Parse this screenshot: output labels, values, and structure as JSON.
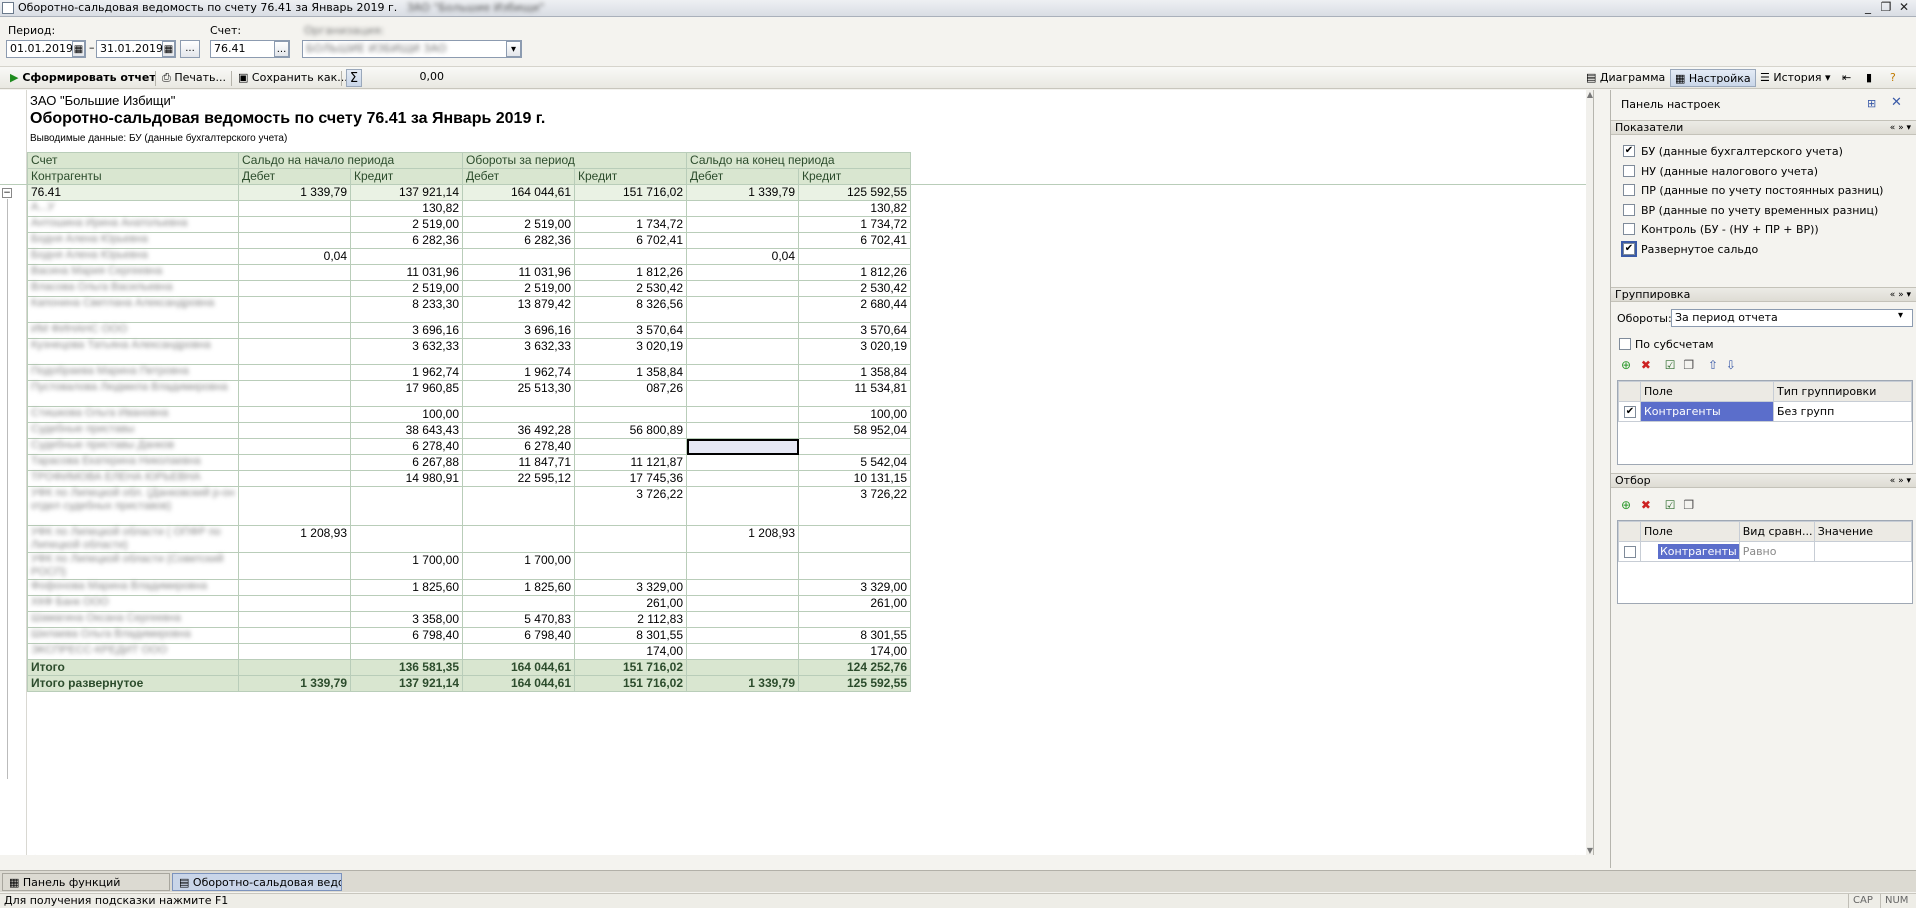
{
  "window": {
    "title": "Оборотно-сальдовая ведомость по счету 76.41 за Январь 2019 г.",
    "title_org_blurred": "ЗАО \"Большие Избищи\"",
    "controls": [
      "_",
      "❐",
      "✕"
    ]
  },
  "params": {
    "period_label": "Период:",
    "date_from": "01.01.2019",
    "date_to": "31.01.2019",
    "dash": "–",
    "more": "...",
    "account_label": "Счет:",
    "account_value": "76.41",
    "org_label": "Организация:",
    "org_value": "БОЛЬШИЕ ИЗБИЩИ ЗАО"
  },
  "toolbar": {
    "generate": "Сформировать отчет",
    "print": "Печать...",
    "save": "Сохранить как...",
    "sigma": "Σ",
    "sum_value": "0,00",
    "diagram": "Диаграмма",
    "settings": "Настройка",
    "history": "История ▾"
  },
  "report": {
    "org": "ЗАО \"Большие Избищи\"",
    "title": "Оборотно-сальдовая ведомость по счету 76.41 за Январь 2019 г.",
    "subtitle": "Выводимые данные:  БУ (данные бухгалтерского учета)",
    "header1": [
      "Счет",
      "Сальдо на начало периода",
      "Обороты за период",
      "Сальдо на конец периода"
    ],
    "header2": [
      "Контрагенты",
      "Дебет",
      "Кредит",
      "Дебет",
      "Кредит",
      "Дебет",
      "Кредит"
    ],
    "account_row": [
      "76.41",
      "1 339,79",
      "137 921,14",
      "164 044,61",
      "151 716,02",
      "1 339,79",
      "125 592,55"
    ],
    "rows": [
      {
        "name": "А...У",
        "v": [
          "",
          "130,82",
          "",
          "",
          "",
          "130,82"
        ],
        "h": 1
      },
      {
        "name": "Антошина Ирина Анатольевна",
        "v": [
          "",
          "2 519,00",
          "2 519,00",
          "1 734,72",
          "",
          "1 734,72"
        ],
        "h": 1
      },
      {
        "name": "Бодня Алена Юрьевна",
        "v": [
          "",
          "6 282,36",
          "6 282,36",
          "6 702,41",
          "",
          "6 702,41"
        ],
        "h": 1
      },
      {
        "name": "Бодня Алена Юрьевна",
        "v": [
          "0,04",
          "",
          "",
          "",
          "0,04",
          ""
        ],
        "h": 1
      },
      {
        "name": "Васина Мария Сергеевна",
        "v": [
          "",
          "11 031,96",
          "11 031,96",
          "1 812,26",
          "",
          "1 812,26"
        ],
        "h": 1
      },
      {
        "name": "Власова Ольга Васильевна",
        "v": [
          "",
          "2 519,00",
          "2 519,00",
          "2 530,42",
          "",
          "2 530,42"
        ],
        "h": 1
      },
      {
        "name": "Капонина Светлана Александровна",
        "v": [
          "",
          "8 233,30",
          "13 879,42",
          "8 326,56",
          "",
          "2 680,44"
        ],
        "h": 2
      },
      {
        "name": "ИМ ФИНАНС ООО",
        "v": [
          "",
          "3 696,16",
          "3 696,16",
          "3 570,64",
          "",
          "3 570,64"
        ],
        "h": 1
      },
      {
        "name": "Кузнецова Татьяна Александровна",
        "v": [
          "",
          "3 632,33",
          "3 632,33",
          "3 020,19",
          "",
          "3 020,19"
        ],
        "h": 2
      },
      {
        "name": "Подобраева Марина Петровна",
        "v": [
          "",
          "1 962,74",
          "1 962,74",
          "1 358,84",
          "",
          "1 358,84"
        ],
        "h": 1
      },
      {
        "name": "Пустовалова Людмила Владимировна",
        "v": [
          "",
          "17 960,85",
          "25 513,30",
          "087,26",
          "",
          "11 534,81"
        ],
        "h": 2
      },
      {
        "name": "Стишкова Ольга Ивановна",
        "v": [
          "",
          "100,00",
          "",
          "",
          "",
          "100,00"
        ],
        "h": 1
      },
      {
        "name": "Судебные приставы",
        "v": [
          "",
          "38 643,43",
          "36 492,28",
          "56 800,89",
          "",
          "58 952,04"
        ],
        "h": 1
      },
      {
        "name": "Судебные приставы Данков",
        "v": [
          "",
          "6 278,40",
          "6 278,40",
          "",
          "",
          ""
        ],
        "h": 1,
        "sel": 4
      },
      {
        "name": "Тарасова Екатерина Николаевна",
        "v": [
          "",
          "6 267,88",
          "11 847,71",
          "11 121,87",
          "",
          "5 542,04"
        ],
        "h": 1
      },
      {
        "name": "ТРОФИМОВА ЕЛЕНА ЮРЬЕВНА",
        "v": [
          "",
          "14 980,91",
          "22 595,12",
          "17 745,36",
          "",
          "10 131,15"
        ],
        "h": 1
      },
      {
        "name": "УФК по Липецкой обл. (Данковский р-он отдел судебных приставов)",
        "v": [
          "",
          "",
          "",
          "3 726,22",
          "",
          "3 726,22"
        ],
        "h": 3
      },
      {
        "name": "УФК по Липецкой области ( ОПФР по Липецкой области)",
        "v": [
          "1 208,93",
          "",
          "",
          "",
          "1 208,93",
          ""
        ],
        "h": 2
      },
      {
        "name": "УФК по Липецкой области (Советский РОСП)",
        "v": [
          "",
          "1 700,00",
          "1 700,00",
          "",
          "",
          ""
        ],
        "h": 2
      },
      {
        "name": "Фофонова Марина Владимировна",
        "v": [
          "",
          "1 825,60",
          "1 825,60",
          "3 329,00",
          "",
          "3 329,00"
        ],
        "h": 1
      },
      {
        "name": "ХКФ Банк ООО",
        "v": [
          "",
          "",
          "",
          "261,00",
          "",
          "261,00"
        ],
        "h": 1
      },
      {
        "name": "Шамагина Оксана Сергеевна",
        "v": [
          "",
          "3 358,00",
          "5 470,83",
          "2 112,83",
          "",
          ""
        ],
        "h": 1
      },
      {
        "name": "Шилаева Ольга Владимировна",
        "v": [
          "",
          "6 798,40",
          "6 798,40",
          "8 301,55",
          "",
          "8 301,55"
        ],
        "h": 1
      },
      {
        "name": "ЭКСПРЕСС-КРЕДИТ ООО",
        "v": [
          "",
          "",
          "",
          "174,00",
          "",
          "174,00"
        ],
        "h": 1
      }
    ],
    "total_row": [
      "Итого",
      "",
      "136 581,35",
      "164 044,61",
      "151 716,02",
      "",
      "124 252,76"
    ],
    "total_expanded_row": [
      "Итого развернутое",
      "1 339,79",
      "137 921,14",
      "164 044,61",
      "151 716,02",
      "1 339,79",
      "125 592,55"
    ]
  },
  "settings": {
    "title": "Панель настроек",
    "indicators_title": "Показатели",
    "indicators": [
      {
        "label": "БУ (данные бухгалтерского учета)",
        "checked": true
      },
      {
        "label": "НУ (данные налогового учета)",
        "checked": false
      },
      {
        "label": "ПР (данные по учету постоянных разниц)",
        "checked": false
      },
      {
        "label": "ВР (данные по учету временных разниц)",
        "checked": false
      },
      {
        "label": "Контроль (БУ - (НУ + ПР + ВР))",
        "checked": false
      },
      {
        "label": "Развернутое сальдо",
        "checked": true
      }
    ],
    "grouping_title": "Группировка",
    "turnover_label": "Обороты:",
    "turnover_value": "За период отчета",
    "by_subaccounts": "По субсчетам",
    "group_cols": [
      "Поле",
      "Тип группировки"
    ],
    "group_row": [
      "Контрагенты",
      "Без групп"
    ],
    "filter_title": "Отбор",
    "filter_cols": [
      "Поле",
      "Вид сравн...",
      "Значение"
    ],
    "filter_row": [
      "Контрагенты",
      "Равно",
      ""
    ]
  },
  "taskbar": {
    "items": [
      "Панель функций",
      "Оборотно-сальдовая ведом..."
    ]
  },
  "status": {
    "hint": "Для получения подсказки нажмите F1",
    "cap": "CAP",
    "num": "NUM"
  },
  "colors": {
    "header_green": "#d9e6d0",
    "grid_line": "#b9cdb9",
    "selection_blue": "#5b6ecb"
  }
}
